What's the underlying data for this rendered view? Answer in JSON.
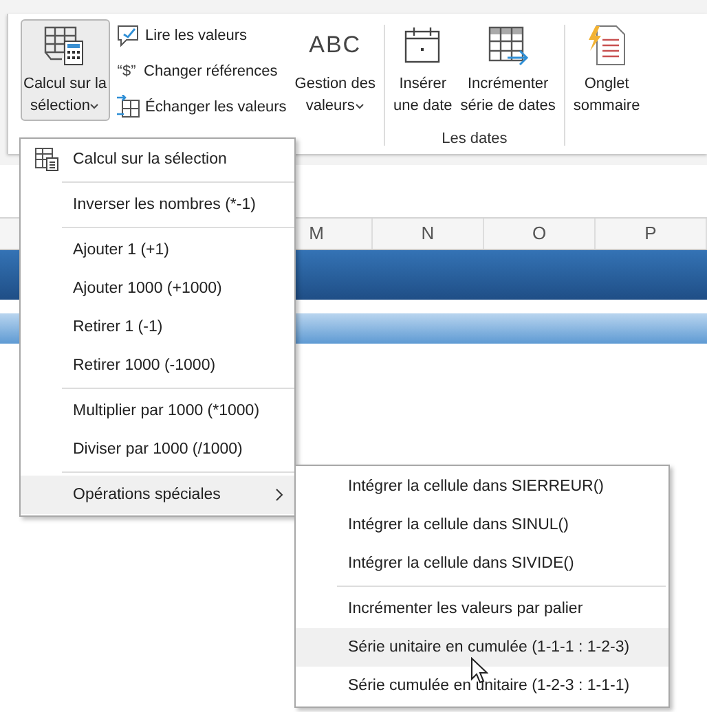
{
  "ribbon": {
    "groups": [
      {
        "controls": [
          {
            "kind": "large",
            "lines": [
              "Calcul sur la",
              "sélection"
            ],
            "dropdown": true,
            "pressed": true
          },
          {
            "kind": "stack",
            "items": [
              {
                "label": "Lire les valeurs"
              },
              {
                "symbol": "“$”",
                "label": "Changer références"
              },
              {
                "label": "Échanger les valeurs"
              }
            ]
          },
          {
            "kind": "large",
            "symbol": "ABC",
            "lines": [
              "Gestion des",
              "valeurs"
            ],
            "dropdown": true,
            "pressed": false
          }
        ]
      },
      {
        "label": "Les dates",
        "controls": [
          {
            "kind": "large",
            "lines": [
              "Insérer",
              "une date"
            ],
            "dropdown": false,
            "pressed": false
          },
          {
            "kind": "large",
            "lines": [
              "Incrémenter",
              "série de dates"
            ],
            "dropdown": false,
            "pressed": false
          }
        ]
      },
      {
        "controls": [
          {
            "kind": "large",
            "lines": [
              "Onglet",
              "sommaire"
            ],
            "dropdown": false,
            "pressed": false
          }
        ]
      }
    ]
  },
  "sheet": {
    "columns": [
      "M",
      "N",
      "O",
      "P"
    ]
  },
  "menu": {
    "items": [
      {
        "kind": "item",
        "label": "Calcul sur la sélection",
        "icon": true,
        "highlighted": false
      },
      {
        "kind": "separator"
      },
      {
        "kind": "item",
        "label": "Inverser les nombres (*-1)",
        "highlighted": false
      },
      {
        "kind": "separator"
      },
      {
        "kind": "item",
        "label": "Ajouter 1 (+1)",
        "highlighted": false
      },
      {
        "kind": "item",
        "label": "Ajouter 1000 (+1000)",
        "highlighted": false
      },
      {
        "kind": "item",
        "label": "Retirer 1 (-1)",
        "highlighted": false
      },
      {
        "kind": "item",
        "label": "Retirer 1000 (-1000)",
        "highlighted": false
      },
      {
        "kind": "separator"
      },
      {
        "kind": "item",
        "label": "Multiplier par 1000 (*1000)",
        "highlighted": false
      },
      {
        "kind": "item",
        "label": "Diviser par 1000 (/1000)",
        "highlighted": false
      },
      {
        "kind": "separator"
      },
      {
        "kind": "submenu",
        "label": "Opérations spéciales",
        "highlighted": true
      }
    ]
  },
  "submenu": {
    "items": [
      {
        "kind": "item",
        "label": "Intégrer la cellule dans SIERREUR()",
        "highlighted": false
      },
      {
        "kind": "item",
        "label": "Intégrer la cellule dans SINUL()",
        "highlighted": false
      },
      {
        "kind": "item",
        "label": "Intégrer la cellule dans SIVIDE()",
        "highlighted": false
      },
      {
        "kind": "separator"
      },
      {
        "kind": "item",
        "label": "Incrémenter les valeurs par palier",
        "highlighted": false
      },
      {
        "kind": "item",
        "label": "Série unitaire en cumulée (1-1-1 : 1-2-3)",
        "highlighted": true
      },
      {
        "kind": "item",
        "label": "Série cumulée en unitaire (1-2-3 : 1-1-1)",
        "highlighted": false
      }
    ]
  }
}
